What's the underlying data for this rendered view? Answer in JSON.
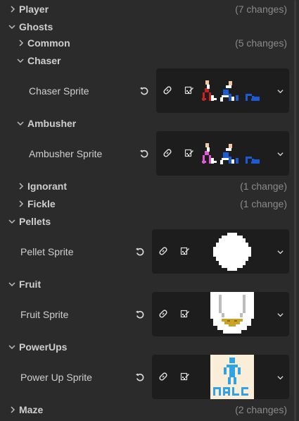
{
  "tree": {
    "player": {
      "label": "Player",
      "changes": "(7 changes)"
    },
    "ghosts": {
      "label": "Ghosts",
      "common": {
        "label": "Common",
        "changes": "(5 changes)"
      },
      "chaser": {
        "label": "Chaser",
        "property": "Chaser Sprite"
      },
      "ambusher": {
        "label": "Ambusher",
        "property": "Ambusher Sprite"
      },
      "ignorant": {
        "label": "Ignorant",
        "changes": "(1 change)"
      },
      "fickle": {
        "label": "Fickle",
        "changes": "(1 change)"
      }
    },
    "pellets": {
      "label": "Pellets",
      "property": "Pellet Sprite"
    },
    "fruit": {
      "label": "Fruit",
      "property": "Fruit Sprite"
    },
    "powerups": {
      "label": "PowerUps",
      "property": "Power Up Sprite"
    },
    "maze": {
      "label": "Maze",
      "changes": "(2 changes)"
    }
  },
  "icons": {
    "collapsed": "chevron-right-icon",
    "expanded": "chevron-down-icon",
    "revert": "revert-icon",
    "link": "link-icon",
    "edit": "edit-sprite-icon",
    "dropdown": "chevron-down-icon"
  },
  "colors": {
    "background": "#2b2b2b",
    "panel": "#1d1d1d",
    "muted_text": "#8a8a8a",
    "sprite_red": "#c8231e",
    "sprite_blue": "#1c5bd6",
    "sprite_pink": "#e05ad8",
    "sprite_light_blue": "#2fa3e6",
    "sprite_gold": "#c9a227"
  }
}
